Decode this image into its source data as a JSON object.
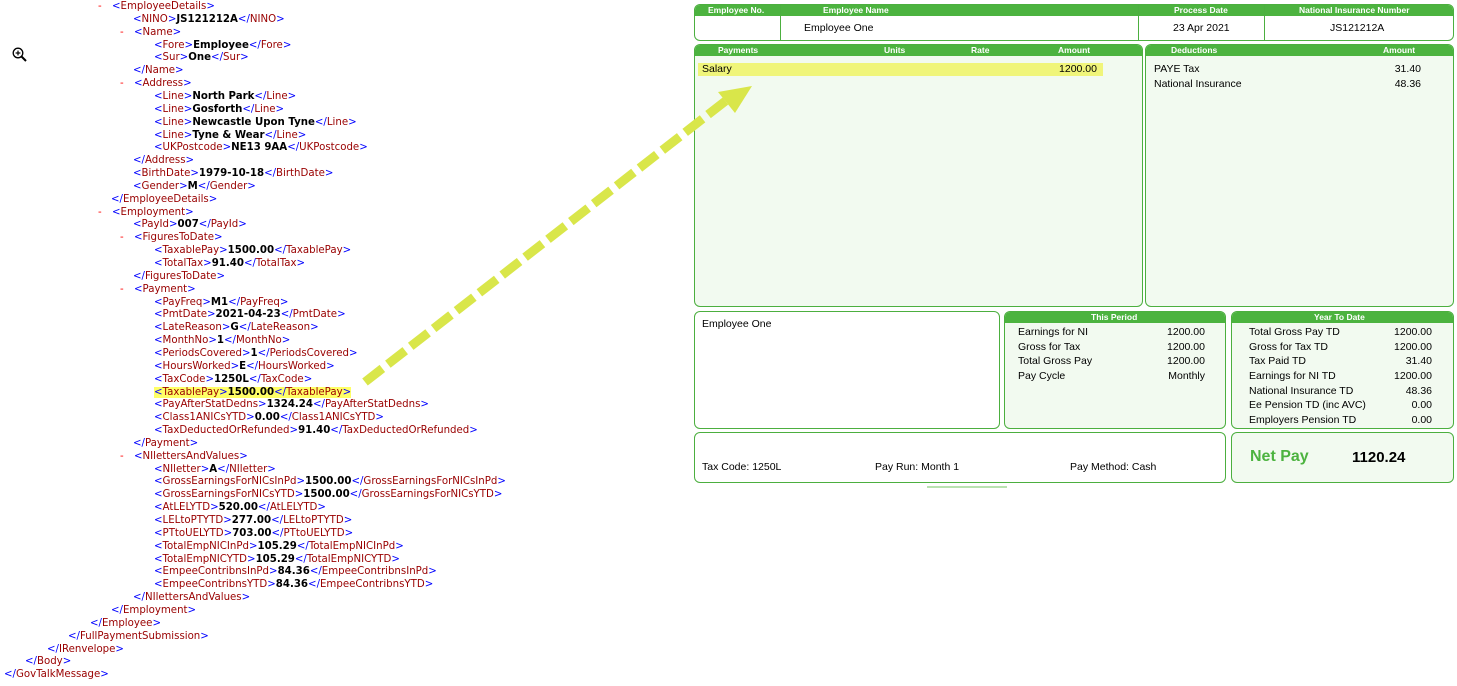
{
  "xml_lines": [
    {
      "i": 98,
      "m": "-",
      "t": "EmployeeDetails"
    },
    {
      "i": 133,
      "t": "NINO",
      "v": "JS121212A"
    },
    {
      "i": 120,
      "m": "-",
      "t": "Name"
    },
    {
      "i": 154,
      "t": "Fore",
      "v": "Employee"
    },
    {
      "i": 154,
      "t": "Sur",
      "v": "One"
    },
    {
      "i": 133,
      "c": "Name"
    },
    {
      "i": 120,
      "m": "-",
      "t": "Address"
    },
    {
      "i": 154,
      "t": "Line",
      "v": "North Park"
    },
    {
      "i": 154,
      "t": "Line",
      "v": "Gosforth"
    },
    {
      "i": 154,
      "t": "Line",
      "v": "Newcastle Upon Tyne"
    },
    {
      "i": 154,
      "t": "Line",
      "v": "Tyne & Wear"
    },
    {
      "i": 154,
      "t": "UKPostcode",
      "v": "NE13 9AA"
    },
    {
      "i": 133,
      "c": "Address"
    },
    {
      "i": 133,
      "t": "BirthDate",
      "v": "1979-10-18"
    },
    {
      "i": 133,
      "t": "Gender",
      "v": "M"
    },
    {
      "i": 111,
      "c": "EmployeeDetails"
    },
    {
      "i": 98,
      "m": "-",
      "t": "Employment"
    },
    {
      "i": 133,
      "t": "PayId",
      "v": "007"
    },
    {
      "i": 120,
      "m": "-",
      "t": "FiguresToDate"
    },
    {
      "i": 154,
      "t": "TaxablePay",
      "v": "1500.00"
    },
    {
      "i": 154,
      "t": "TotalTax",
      "v": "91.40"
    },
    {
      "i": 133,
      "c": "FiguresToDate"
    },
    {
      "i": 120,
      "m": "-",
      "t": "Payment"
    },
    {
      "i": 154,
      "t": "PayFreq",
      "v": "M1"
    },
    {
      "i": 154,
      "t": "PmtDate",
      "v": "2021-04-23"
    },
    {
      "i": 154,
      "t": "LateReason",
      "v": "G"
    },
    {
      "i": 154,
      "t": "MonthNo",
      "v": "1"
    },
    {
      "i": 154,
      "t": "PeriodsCovered",
      "v": "1"
    },
    {
      "i": 154,
      "t": "HoursWorked",
      "v": "E"
    },
    {
      "i": 154,
      "t": "TaxCode",
      "v": "1250L"
    },
    {
      "i": 154,
      "t": "TaxablePay",
      "v": "1500.00",
      "hl": true
    },
    {
      "i": 154,
      "t": "PayAfterStatDedns",
      "v": "1324.24"
    },
    {
      "i": 154,
      "t": "Class1ANICsYTD",
      "v": "0.00"
    },
    {
      "i": 154,
      "t": "TaxDeductedOrRefunded",
      "v": "91.40"
    },
    {
      "i": 133,
      "c": "Payment"
    },
    {
      "i": 120,
      "m": "-",
      "t": "NIlettersAndValues"
    },
    {
      "i": 154,
      "t": "NIletter",
      "v": "A"
    },
    {
      "i": 154,
      "t": "GrossEarningsForNICsInPd",
      "v": "1500.00"
    },
    {
      "i": 154,
      "t": "GrossEarningsForNICsYTD",
      "v": "1500.00"
    },
    {
      "i": 154,
      "t": "AtLELYTD",
      "v": "520.00"
    },
    {
      "i": 154,
      "t": "LELtoPTYTD",
      "v": "277.00"
    },
    {
      "i": 154,
      "t": "PTtoUELYTD",
      "v": "703.00"
    },
    {
      "i": 154,
      "t": "TotalEmpNICInPd",
      "v": "105.29"
    },
    {
      "i": 154,
      "t": "TotalEmpNICYTD",
      "v": "105.29"
    },
    {
      "i": 154,
      "t": "EmpeeContribnsInPd",
      "v": "84.36"
    },
    {
      "i": 154,
      "t": "EmpeeContribnsYTD",
      "v": "84.36"
    },
    {
      "i": 133,
      "c": "NIlettersAndValues"
    },
    {
      "i": 111,
      "c": "Employment"
    },
    {
      "i": 90,
      "c": "Employee"
    },
    {
      "i": 68,
      "c": "FullPaymentSubmission"
    },
    {
      "i": 47,
      "c": "IRenvelope"
    },
    {
      "i": 25,
      "c": "Body"
    },
    {
      "i": 4,
      "c": "GovTalkMessage"
    }
  ],
  "colors": {
    "accent": "#4cb33f",
    "highlight": "#ffff66",
    "tag": "#990000",
    "bracket": "#0000ff",
    "arrow": "#d9e64a"
  },
  "payslip": {
    "header": {
      "labels": {
        "emp_no": "Employee No.",
        "emp_name": "Employee Name",
        "process_date": "Process Date",
        "ni_number": "National Insurance Number"
      },
      "values": {
        "emp_no": "",
        "emp_name": "Employee One",
        "process_date": "23 Apr 2021",
        "ni_number": "JS121212A"
      }
    },
    "payments": {
      "columns": {
        "payments": "Payments",
        "units": "Units",
        "rate": "Rate",
        "amount": "Amount"
      },
      "rows": [
        {
          "desc": "Salary",
          "amount": "1200.00"
        }
      ]
    },
    "deductions": {
      "columns": {
        "deductions": "Deductions",
        "amount": "Amount"
      },
      "rows": [
        {
          "desc": "PAYE Tax",
          "amount": "31.40"
        },
        {
          "desc": "National Insurance",
          "amount": "48.36"
        }
      ]
    },
    "employee_block": {
      "name": "Employee One"
    },
    "this_period": {
      "title": "This Period",
      "rows": [
        {
          "label": "Earnings for NI",
          "value": "1200.00"
        },
        {
          "label": "Gross for Tax",
          "value": "1200.00"
        },
        {
          "label": "Total Gross Pay",
          "value": "1200.00"
        },
        {
          "label": "Pay Cycle",
          "value": "Monthly"
        }
      ]
    },
    "year_to_date": {
      "title": "Year To Date",
      "rows": [
        {
          "label": "Total Gross Pay TD",
          "value": "1200.00"
        },
        {
          "label": "Gross for Tax TD",
          "value": "1200.00"
        },
        {
          "label": "Tax Paid TD",
          "value": "31.40"
        },
        {
          "label": "Earnings for NI TD",
          "value": "1200.00"
        },
        {
          "label": "National Insurance TD",
          "value": "48.36"
        },
        {
          "label": "Ee Pension TD (inc AVC)",
          "value": "0.00"
        },
        {
          "label": "Employers Pension TD",
          "value": "0.00"
        }
      ]
    },
    "footer": {
      "tax_code": "Tax Code: 1250L",
      "pay_run": "Pay Run: Month 1",
      "pay_method": "Pay Method: Cash"
    },
    "net_pay": {
      "label": "Net Pay",
      "value": "1120.24"
    }
  }
}
